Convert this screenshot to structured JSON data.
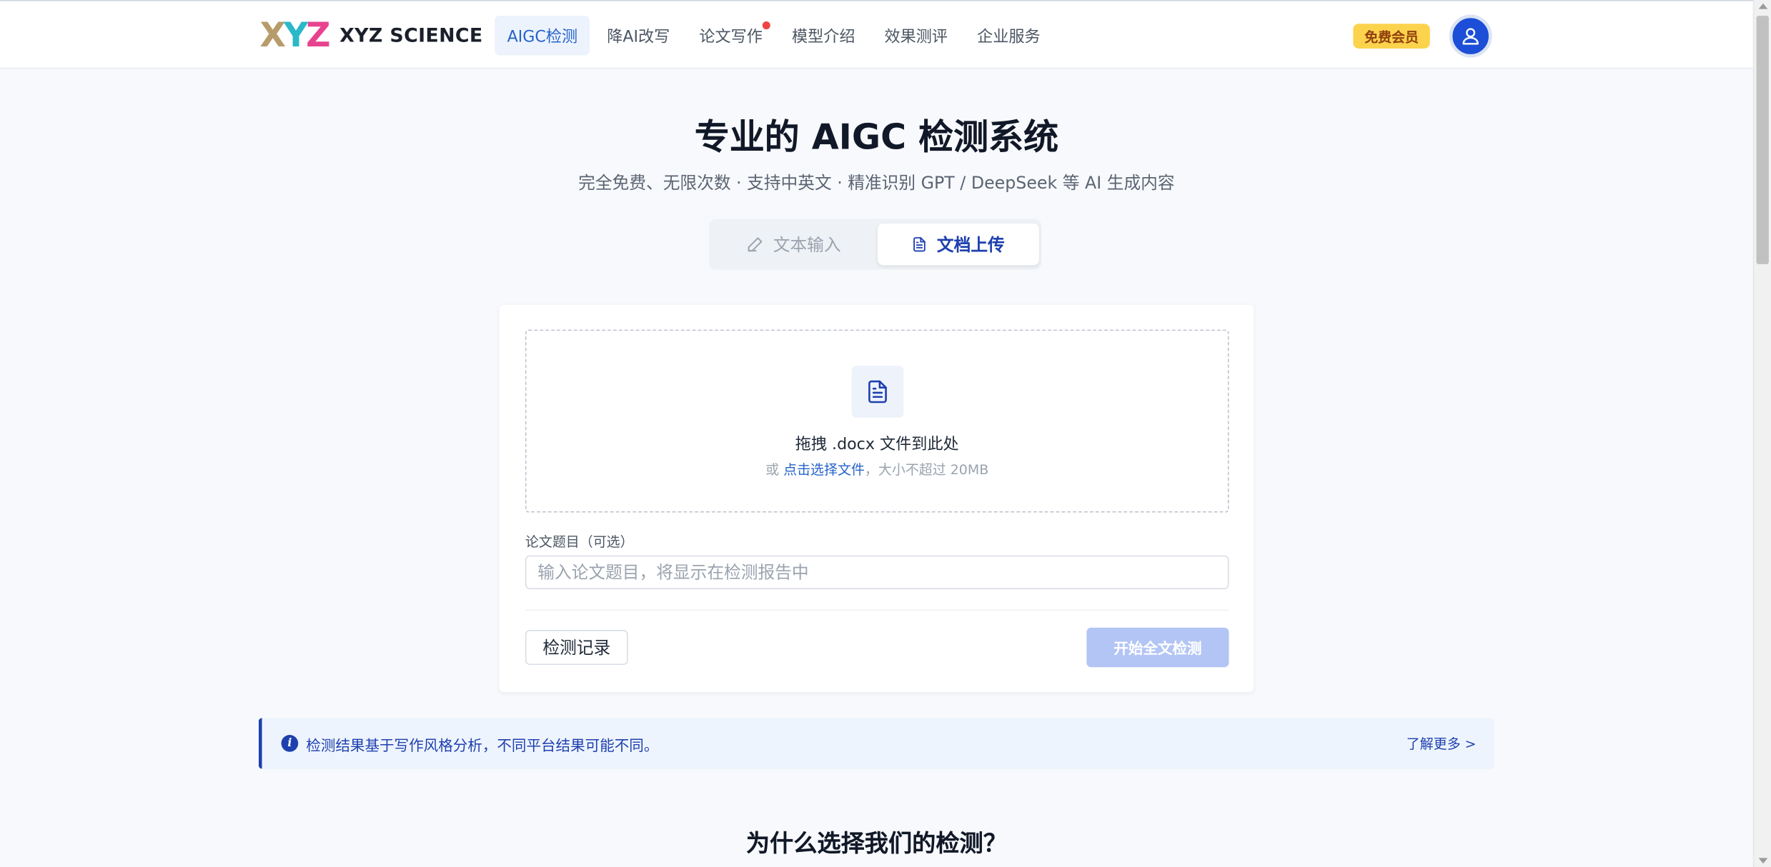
{
  "header": {
    "logo_letters": [
      "X",
      "Y",
      "Z"
    ],
    "logo_text": "XYZ SCIENCE",
    "nav": [
      {
        "label": "AIGC检测",
        "active": true
      },
      {
        "label": "降AI改写"
      },
      {
        "label": "论文写作",
        "has_dot": true
      },
      {
        "label": "模型介绍"
      },
      {
        "label": "效果测评"
      },
      {
        "label": "企业服务"
      }
    ],
    "vip_label": "免费会员",
    "avatar_icon": "user-icon"
  },
  "hero": {
    "title": "专业的 AIGC 检测系统",
    "subtitle": "完全免费、无限次数 · 支持中英文 · 精准识别 GPT / DeepSeek 等 AI 生成内容"
  },
  "mode_tabs": [
    {
      "label": "文本输入",
      "icon": "pencil-icon",
      "active": false
    },
    {
      "label": "文档上传",
      "icon": "document-icon",
      "active": true
    }
  ],
  "upload": {
    "icon": "document-icon",
    "main_text": "拖拽 .docx 文件到此处",
    "sub_prefix": "或 ",
    "sub_link": "点击选择文件",
    "sub_suffix": "，大小不超过 20MB"
  },
  "form": {
    "title_label": "论文题目（可选）",
    "title_placeholder": "输入论文题目，将显示在检测报告中",
    "title_value": "",
    "history_button": "检测记录",
    "start_button": "开始全文检测"
  },
  "notice": {
    "icon": "info-icon",
    "text": "检测结果基于写作风格分析，不同平台结果可能不同。",
    "link": "了解更多 >"
  },
  "why_section": {
    "title": "为什么选择我们的检测？"
  },
  "colors": {
    "accent": "#1e40af",
    "link": "#2563c9",
    "vip_bg": "#fcd34d",
    "start_disabled": "#b3c5f5",
    "logo_x": "#b79c6b",
    "logo_y": "#2bb8c9",
    "logo_z": "#e8438f"
  }
}
